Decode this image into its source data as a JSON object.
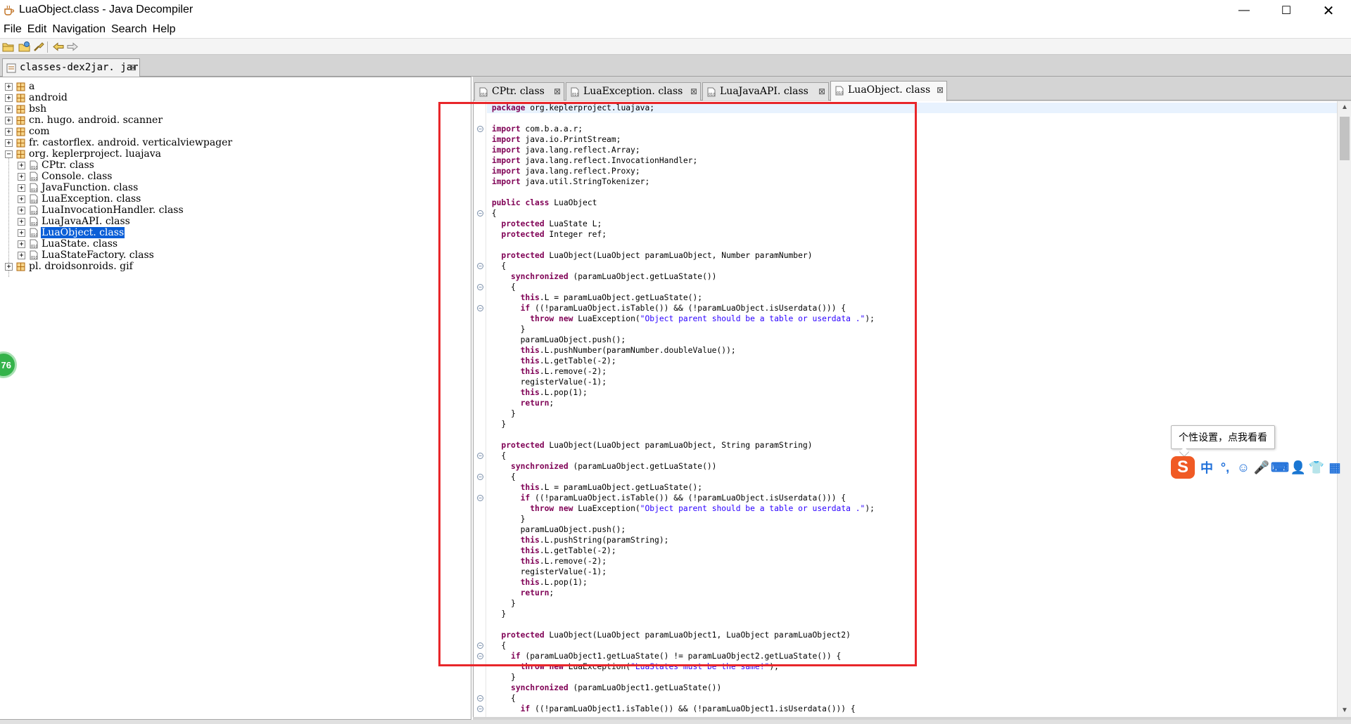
{
  "window": {
    "title": "LuaObject.class - Java Decompiler",
    "controls": {
      "minimize": "—",
      "maximize": "☐",
      "close": "✕"
    }
  },
  "menu": [
    "File",
    "Edit",
    "Navigation",
    "Search",
    "Help"
  ],
  "toolbar": {
    "icons": [
      "open-file-icon",
      "open-type-icon",
      "search-icon",
      "back-icon",
      "forward-icon"
    ]
  },
  "jar_tab": {
    "label": "classes-dex2jar. jar",
    "close": "⊠"
  },
  "tree": {
    "packages": [
      {
        "label": "a",
        "expanded": false
      },
      {
        "label": "android",
        "expanded": false
      },
      {
        "label": "bsh",
        "expanded": false
      },
      {
        "label": "cn. hugo. android. scanner",
        "expanded": false
      },
      {
        "label": "com",
        "expanded": false
      },
      {
        "label": "fr. castorflex. android. verticalviewpager",
        "expanded": false
      },
      {
        "label": "org. keplerproject. luajava",
        "expanded": true
      },
      {
        "label": "pl. droidsonroids. gif",
        "expanded": false
      }
    ],
    "classes": [
      {
        "label": "CPtr. class",
        "selected": false
      },
      {
        "label": "Console. class",
        "selected": false
      },
      {
        "label": "JavaFunction. class",
        "selected": false
      },
      {
        "label": "LuaException. class",
        "selected": false
      },
      {
        "label": "LuaInvocationHandler. class",
        "selected": false
      },
      {
        "label": "LuaJavaAPI. class",
        "selected": false
      },
      {
        "label": "LuaObject. class",
        "selected": true
      },
      {
        "label": "LuaState. class",
        "selected": false
      },
      {
        "label": "LuaStateFactory. class",
        "selected": false
      }
    ],
    "badge": "76"
  },
  "editor": {
    "tabs": [
      {
        "label": "CPtr. class",
        "active": false
      },
      {
        "label": "LuaException. class",
        "active": false
      },
      {
        "label": "LuaJavaAPI. class",
        "active": false
      },
      {
        "label": "LuaObject. class",
        "active": true
      }
    ],
    "tab_close": "⊠",
    "code": [
      "package org.keplerproject.luajava;",
      "",
      "import com.b.a.a.r;",
      "import java.io.PrintStream;",
      "import java.lang.reflect.Array;",
      "import java.lang.reflect.InvocationHandler;",
      "import java.lang.reflect.Proxy;",
      "import java.util.StringTokenizer;",
      "",
      "public class LuaObject",
      "{",
      "  protected LuaState L;",
      "  protected Integer ref;",
      "",
      "  protected LuaObject(LuaObject paramLuaObject, Number paramNumber)",
      "  {",
      "    synchronized (paramLuaObject.getLuaState())",
      "    {",
      "      this.L = paramLuaObject.getLuaState();",
      "      if ((!paramLuaObject.isTable()) && (!paramLuaObject.isUserdata())) {",
      "        throw new LuaException(\"Object parent should be a table or userdata .\");",
      "      }",
      "      paramLuaObject.push();",
      "      this.L.pushNumber(paramNumber.doubleValue());",
      "      this.L.getTable(-2);",
      "      this.L.remove(-2);",
      "      registerValue(-1);",
      "      this.L.pop(1);",
      "      return;",
      "    }",
      "  }",
      "",
      "  protected LuaObject(LuaObject paramLuaObject, String paramString)",
      "  {",
      "    synchronized (paramLuaObject.getLuaState())",
      "    {",
      "      this.L = paramLuaObject.getLuaState();",
      "      if ((!paramLuaObject.isTable()) && (!paramLuaObject.isUserdata())) {",
      "        throw new LuaException(\"Object parent should be a table or userdata .\");",
      "      }",
      "      paramLuaObject.push();",
      "      this.L.pushString(paramString);",
      "      this.L.getTable(-2);",
      "      this.L.remove(-2);",
      "      registerValue(-1);",
      "      this.L.pop(1);",
      "      return;",
      "    }",
      "  }",
      "",
      "  protected LuaObject(LuaObject paramLuaObject1, LuaObject paramLuaObject2)",
      "  {",
      "    if (paramLuaObject1.getLuaState() != paramLuaObject2.getLuaState()) {",
      "      throw new LuaException(\"LuaStates must be the same!\");",
      "    }",
      "    synchronized (paramLuaObject1.getLuaState())",
      "    {",
      "      if ((!paramLuaObject1.isTable()) && (!paramLuaObject1.isUserdata())) {"
    ],
    "fold_markers": [
      "⊖",
      "⊖",
      "⊖",
      "⊖",
      "⊖",
      "⊖",
      "⊖",
      "⊖",
      "⊖",
      "⊖",
      "⊖",
      "⊖",
      "⊖",
      "⊖"
    ]
  },
  "ime": {
    "tooltip": "个性设置，点我看看",
    "logo": "S",
    "items": [
      "中",
      "°,",
      "☺",
      "🎤",
      "⌨",
      "👤",
      "👕",
      "▦"
    ]
  },
  "colors": {
    "keyword": "#7f0055",
    "string": "#2a00ff",
    "selection": "#0a5ed7",
    "annotation": "#e8262a"
  }
}
